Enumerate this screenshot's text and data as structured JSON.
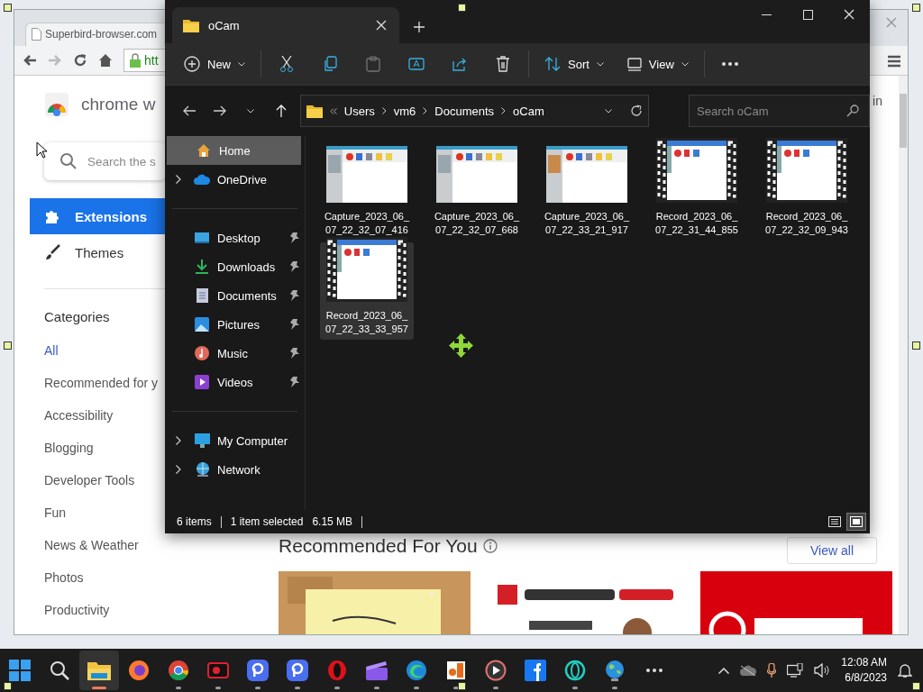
{
  "browser": {
    "tab_title": "Superbird-browser.com",
    "url": "htt",
    "store_title": "chrome w",
    "search_placeholder": "Search the s",
    "header_link": "in",
    "nav": [
      {
        "label": "Extensions",
        "kind": "puzzle",
        "selected": true
      },
      {
        "label": "Themes",
        "kind": "brush",
        "selected": false
      }
    ],
    "categories_heading": "Categories",
    "categories": [
      {
        "label": "All",
        "selected": true
      },
      {
        "label": "Recommended for y",
        "selected": false
      },
      {
        "label": "Accessibility",
        "selected": false
      },
      {
        "label": "Blogging",
        "selected": false
      },
      {
        "label": "Developer Tools",
        "selected": false
      },
      {
        "label": "Fun",
        "selected": false
      },
      {
        "label": "News & Weather",
        "selected": false
      },
      {
        "label": "Photos",
        "selected": false
      },
      {
        "label": "Productivity",
        "selected": false
      }
    ],
    "section_title": "Recommended For You",
    "view_all": "View all"
  },
  "explorer": {
    "tab_title": "oCam",
    "toolbar": [
      {
        "kind": "new",
        "label": "New",
        "disabled": false
      },
      {
        "kind": "cut",
        "disabled": false
      },
      {
        "kind": "copy",
        "disabled": false
      },
      {
        "kind": "paste",
        "disabled": true
      },
      {
        "kind": "rename",
        "disabled": false
      },
      {
        "kind": "share",
        "disabled": false
      },
      {
        "kind": "delete",
        "disabled": false
      },
      {
        "kind": "sort",
        "label": "Sort",
        "disabled": false
      },
      {
        "kind": "view",
        "label": "View",
        "disabled": false
      },
      {
        "kind": "more",
        "disabled": false
      }
    ],
    "path": [
      "Users",
      "vm6",
      "Documents",
      "oCam"
    ],
    "search_placeholder": "Search oCam",
    "nav_groups": [
      [
        {
          "label": "Home",
          "kind": "home",
          "pinned": false,
          "selected": true
        },
        {
          "label": "OneDrive",
          "kind": "cloud",
          "pinned": false,
          "selected": false
        }
      ],
      [
        {
          "label": "Desktop",
          "kind": "desktop",
          "pinned": true,
          "selected": false
        },
        {
          "label": "Downloads",
          "kind": "download",
          "pinned": true,
          "selected": false
        },
        {
          "label": "Documents",
          "kind": "document",
          "pinned": true,
          "selected": false
        },
        {
          "label": "Pictures",
          "kind": "pictures",
          "pinned": true,
          "selected": false
        },
        {
          "label": "Music",
          "kind": "music",
          "pinned": true,
          "selected": false
        },
        {
          "label": "Videos",
          "kind": "videos",
          "pinned": true,
          "selected": false
        }
      ],
      [
        {
          "label": "My Computer",
          "kind": "computer",
          "pinned": false,
          "selected": false
        },
        {
          "label": "Network",
          "kind": "network",
          "pinned": false,
          "selected": false
        }
      ]
    ],
    "files": [
      {
        "name": "Capture_2023_06_07_22_32_07_416",
        "kind": "capture",
        "selected": false
      },
      {
        "name": "Capture_2023_06_07_22_32_07_668",
        "kind": "capture",
        "selected": false
      },
      {
        "name": "Capture_2023_06_07_22_33_21_917",
        "kind": "capture",
        "selected": false
      },
      {
        "name": "Record_2023_06_07_22_31_44_855",
        "kind": "record",
        "selected": false
      },
      {
        "name": "Record_2023_06_07_22_32_09_943",
        "kind": "record",
        "selected": false
      },
      {
        "name": "Record_2023_06_07_22_33_33_957",
        "kind": "record",
        "selected": true
      }
    ],
    "status": {
      "count": "6 items",
      "selection": "1 item selected",
      "size": "6.15 MB"
    },
    "views": [
      {
        "kind": "details",
        "selected": false
      },
      {
        "kind": "tiles",
        "selected": true
      }
    ]
  },
  "taskbar": {
    "apps": [
      {
        "kind": "start",
        "active": false,
        "running": false
      },
      {
        "kind": "search",
        "active": false,
        "running": false
      },
      {
        "kind": "folder",
        "active": true,
        "running": true
      },
      {
        "kind": "firefox",
        "active": false,
        "running": false
      },
      {
        "kind": "chrome",
        "active": false,
        "running": true
      },
      {
        "kind": "recorder",
        "active": false,
        "running": true
      },
      {
        "kind": "pblue",
        "active": false,
        "running": true
      },
      {
        "kind": "pblue2",
        "active": false,
        "running": true
      },
      {
        "kind": "opera",
        "active": false,
        "running": true
      },
      {
        "kind": "clapper",
        "active": false,
        "running": true
      },
      {
        "kind": "edge",
        "active": false,
        "running": true
      },
      {
        "kind": "office",
        "active": false,
        "running": true
      },
      {
        "kind": "play",
        "active": false,
        "running": true
      },
      {
        "kind": "facebook",
        "active": false,
        "running": false
      },
      {
        "kind": "ring",
        "active": false,
        "running": true
      },
      {
        "kind": "globe",
        "active": false,
        "running": true
      },
      {
        "kind": "more",
        "active": false,
        "running": false
      }
    ],
    "time": "12:08 AM",
    "date": "6/8/2023"
  }
}
